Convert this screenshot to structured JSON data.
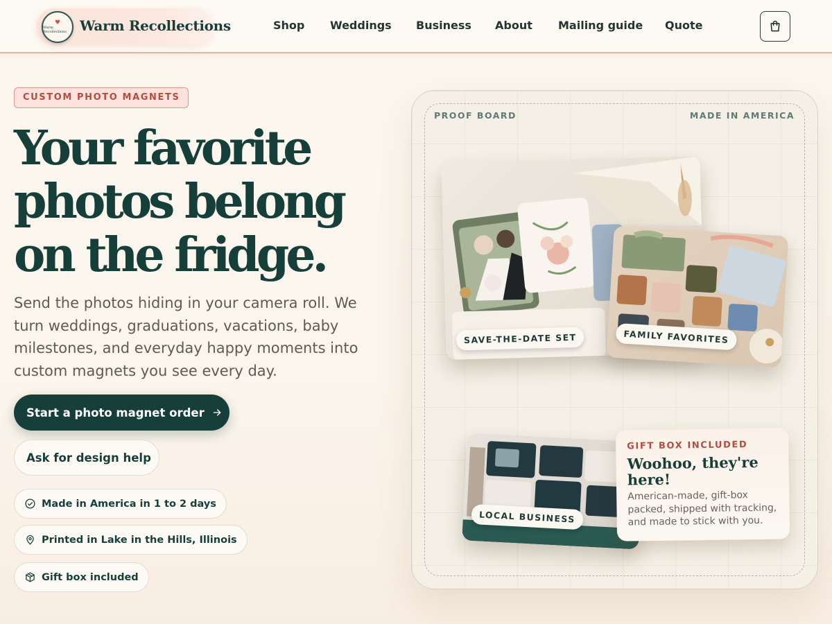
{
  "header": {
    "brand_name": "Warm Recollections",
    "logo_text": "Warm Recollections",
    "nav": [
      "Shop",
      "Weddings",
      "Business",
      "About",
      "Mailing guide",
      "Quote"
    ],
    "cart_icon": "shopping-bag-icon"
  },
  "hero": {
    "eyebrow": "CUSTOM PHOTO MAGNETS",
    "title_lines": [
      "Your favorite",
      "photos belong",
      "on the fridge."
    ],
    "description": "Send the photos hiding in your camera roll. We turn weddings, graduations, vacations, baby milestones, and everyday happy moments into custom magnets you see every day.",
    "primary_cta": "Start a photo magnet order",
    "secondary_cta": "Ask for design help",
    "chips": [
      {
        "icon": "check-circle-icon",
        "label": "Made in America in 1 to 2 days"
      },
      {
        "icon": "location-pin-icon",
        "label": "Printed in Lake in the Hills, Illinois"
      },
      {
        "icon": "package-icon",
        "label": "Gift box included"
      }
    ]
  },
  "board": {
    "label_left": "PROOF BOARD",
    "label_right": "MADE IN AMERICA",
    "cards": [
      {
        "tag": "SAVE-THE-DATE SET"
      },
      {
        "tag": "FAMILY FAVORITES"
      },
      {
        "tag": "LOCAL BUSINESS"
      }
    ],
    "gift": {
      "eyebrow": "GIFT BOX INCLUDED",
      "title": "Woohoo, they're here!",
      "body": "American-made, gift-box packed, shipped with tracking, and made to stick with you."
    }
  },
  "colors": {
    "primary": "#173f3a",
    "accent": "#b44d40",
    "background": "#fbf7ef"
  }
}
